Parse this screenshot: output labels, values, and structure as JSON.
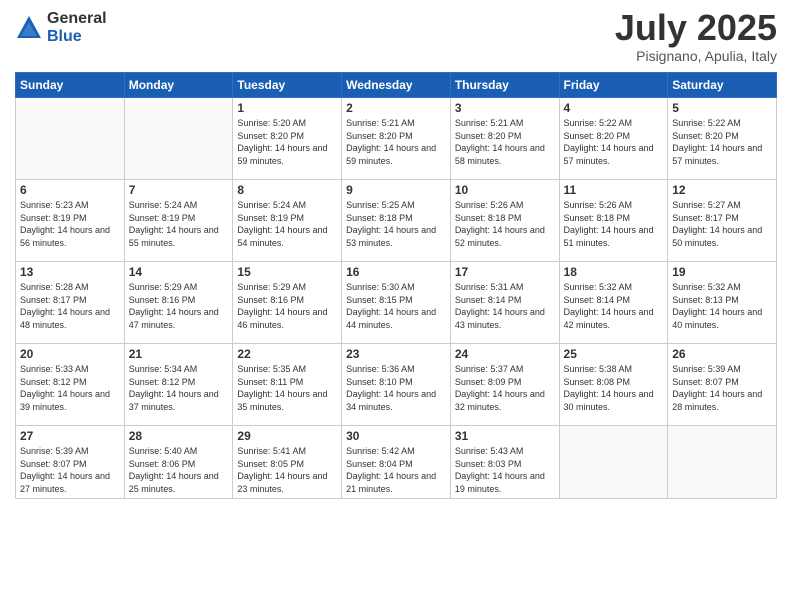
{
  "logo": {
    "general": "General",
    "blue": "Blue"
  },
  "header": {
    "month": "July 2025",
    "location": "Pisignano, Apulia, Italy"
  },
  "weekdays": [
    "Sunday",
    "Monday",
    "Tuesday",
    "Wednesday",
    "Thursday",
    "Friday",
    "Saturday"
  ],
  "weeks": [
    [
      {
        "day": "",
        "sunrise": "",
        "sunset": "",
        "daylight": ""
      },
      {
        "day": "",
        "sunrise": "",
        "sunset": "",
        "daylight": ""
      },
      {
        "day": "1",
        "sunrise": "Sunrise: 5:20 AM",
        "sunset": "Sunset: 8:20 PM",
        "daylight": "Daylight: 14 hours and 59 minutes."
      },
      {
        "day": "2",
        "sunrise": "Sunrise: 5:21 AM",
        "sunset": "Sunset: 8:20 PM",
        "daylight": "Daylight: 14 hours and 59 minutes."
      },
      {
        "day": "3",
        "sunrise": "Sunrise: 5:21 AM",
        "sunset": "Sunset: 8:20 PM",
        "daylight": "Daylight: 14 hours and 58 minutes."
      },
      {
        "day": "4",
        "sunrise": "Sunrise: 5:22 AM",
        "sunset": "Sunset: 8:20 PM",
        "daylight": "Daylight: 14 hours and 57 minutes."
      },
      {
        "day": "5",
        "sunrise": "Sunrise: 5:22 AM",
        "sunset": "Sunset: 8:20 PM",
        "daylight": "Daylight: 14 hours and 57 minutes."
      }
    ],
    [
      {
        "day": "6",
        "sunrise": "Sunrise: 5:23 AM",
        "sunset": "Sunset: 8:19 PM",
        "daylight": "Daylight: 14 hours and 56 minutes."
      },
      {
        "day": "7",
        "sunrise": "Sunrise: 5:24 AM",
        "sunset": "Sunset: 8:19 PM",
        "daylight": "Daylight: 14 hours and 55 minutes."
      },
      {
        "day": "8",
        "sunrise": "Sunrise: 5:24 AM",
        "sunset": "Sunset: 8:19 PM",
        "daylight": "Daylight: 14 hours and 54 minutes."
      },
      {
        "day": "9",
        "sunrise": "Sunrise: 5:25 AM",
        "sunset": "Sunset: 8:18 PM",
        "daylight": "Daylight: 14 hours and 53 minutes."
      },
      {
        "day": "10",
        "sunrise": "Sunrise: 5:26 AM",
        "sunset": "Sunset: 8:18 PM",
        "daylight": "Daylight: 14 hours and 52 minutes."
      },
      {
        "day": "11",
        "sunrise": "Sunrise: 5:26 AM",
        "sunset": "Sunset: 8:18 PM",
        "daylight": "Daylight: 14 hours and 51 minutes."
      },
      {
        "day": "12",
        "sunrise": "Sunrise: 5:27 AM",
        "sunset": "Sunset: 8:17 PM",
        "daylight": "Daylight: 14 hours and 50 minutes."
      }
    ],
    [
      {
        "day": "13",
        "sunrise": "Sunrise: 5:28 AM",
        "sunset": "Sunset: 8:17 PM",
        "daylight": "Daylight: 14 hours and 48 minutes."
      },
      {
        "day": "14",
        "sunrise": "Sunrise: 5:29 AM",
        "sunset": "Sunset: 8:16 PM",
        "daylight": "Daylight: 14 hours and 47 minutes."
      },
      {
        "day": "15",
        "sunrise": "Sunrise: 5:29 AM",
        "sunset": "Sunset: 8:16 PM",
        "daylight": "Daylight: 14 hours and 46 minutes."
      },
      {
        "day": "16",
        "sunrise": "Sunrise: 5:30 AM",
        "sunset": "Sunset: 8:15 PM",
        "daylight": "Daylight: 14 hours and 44 minutes."
      },
      {
        "day": "17",
        "sunrise": "Sunrise: 5:31 AM",
        "sunset": "Sunset: 8:14 PM",
        "daylight": "Daylight: 14 hours and 43 minutes."
      },
      {
        "day": "18",
        "sunrise": "Sunrise: 5:32 AM",
        "sunset": "Sunset: 8:14 PM",
        "daylight": "Daylight: 14 hours and 42 minutes."
      },
      {
        "day": "19",
        "sunrise": "Sunrise: 5:32 AM",
        "sunset": "Sunset: 8:13 PM",
        "daylight": "Daylight: 14 hours and 40 minutes."
      }
    ],
    [
      {
        "day": "20",
        "sunrise": "Sunrise: 5:33 AM",
        "sunset": "Sunset: 8:12 PM",
        "daylight": "Daylight: 14 hours and 39 minutes."
      },
      {
        "day": "21",
        "sunrise": "Sunrise: 5:34 AM",
        "sunset": "Sunset: 8:12 PM",
        "daylight": "Daylight: 14 hours and 37 minutes."
      },
      {
        "day": "22",
        "sunrise": "Sunrise: 5:35 AM",
        "sunset": "Sunset: 8:11 PM",
        "daylight": "Daylight: 14 hours and 35 minutes."
      },
      {
        "day": "23",
        "sunrise": "Sunrise: 5:36 AM",
        "sunset": "Sunset: 8:10 PM",
        "daylight": "Daylight: 14 hours and 34 minutes."
      },
      {
        "day": "24",
        "sunrise": "Sunrise: 5:37 AM",
        "sunset": "Sunset: 8:09 PM",
        "daylight": "Daylight: 14 hours and 32 minutes."
      },
      {
        "day": "25",
        "sunrise": "Sunrise: 5:38 AM",
        "sunset": "Sunset: 8:08 PM",
        "daylight": "Daylight: 14 hours and 30 minutes."
      },
      {
        "day": "26",
        "sunrise": "Sunrise: 5:39 AM",
        "sunset": "Sunset: 8:07 PM",
        "daylight": "Daylight: 14 hours and 28 minutes."
      }
    ],
    [
      {
        "day": "27",
        "sunrise": "Sunrise: 5:39 AM",
        "sunset": "Sunset: 8:07 PM",
        "daylight": "Daylight: 14 hours and 27 minutes."
      },
      {
        "day": "28",
        "sunrise": "Sunrise: 5:40 AM",
        "sunset": "Sunset: 8:06 PM",
        "daylight": "Daylight: 14 hours and 25 minutes."
      },
      {
        "day": "29",
        "sunrise": "Sunrise: 5:41 AM",
        "sunset": "Sunset: 8:05 PM",
        "daylight": "Daylight: 14 hours and 23 minutes."
      },
      {
        "day": "30",
        "sunrise": "Sunrise: 5:42 AM",
        "sunset": "Sunset: 8:04 PM",
        "daylight": "Daylight: 14 hours and 21 minutes."
      },
      {
        "day": "31",
        "sunrise": "Sunrise: 5:43 AM",
        "sunset": "Sunset: 8:03 PM",
        "daylight": "Daylight: 14 hours and 19 minutes."
      },
      {
        "day": "",
        "sunrise": "",
        "sunset": "",
        "daylight": ""
      },
      {
        "day": "",
        "sunrise": "",
        "sunset": "",
        "daylight": ""
      }
    ]
  ]
}
